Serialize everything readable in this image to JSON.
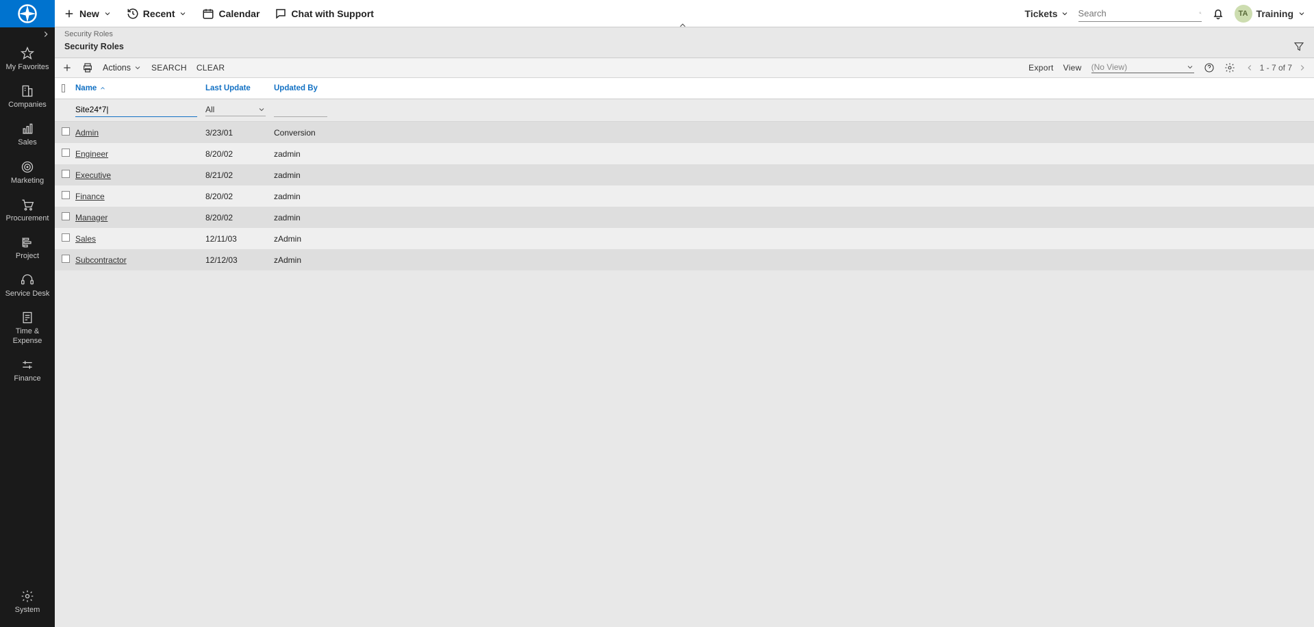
{
  "sidebar": {
    "items": [
      {
        "key": "favorites",
        "label": "My Favorites"
      },
      {
        "key": "companies",
        "label": "Companies"
      },
      {
        "key": "sales",
        "label": "Sales"
      },
      {
        "key": "marketing",
        "label": "Marketing"
      },
      {
        "key": "procurement",
        "label": "Procurement"
      },
      {
        "key": "project",
        "label": "Project"
      },
      {
        "key": "servicedesk",
        "label": "Service Desk"
      },
      {
        "key": "timeexpense",
        "label": "Time & Expense"
      },
      {
        "key": "finance",
        "label": "Finance"
      }
    ],
    "system_label": "System"
  },
  "topbar": {
    "new_label": "New",
    "recent_label": "Recent",
    "calendar_label": "Calendar",
    "chat_label": "Chat with Support",
    "tickets_label": "Tickets",
    "search_placeholder": "Search",
    "avatar_initials": "TA",
    "user_label": "Training"
  },
  "breadcrumb": "Security Roles",
  "page_title": "Security Roles",
  "toolbar": {
    "actions_label": "Actions",
    "search_label": "SEARCH",
    "clear_label": "CLEAR",
    "export_label": "Export",
    "view_label": "View",
    "view_value": "(No View)",
    "pager_text": "1 - 7 of 7"
  },
  "columns": {
    "name": "Name",
    "last_update": "Last Update",
    "updated_by": "Updated By"
  },
  "filters": {
    "name_value": "Site24*7|",
    "last_update_value": "All",
    "updated_by_value": ""
  },
  "rows": [
    {
      "name": "Admin",
      "last_update": "3/23/01",
      "updated_by": "Conversion"
    },
    {
      "name": "Engineer",
      "last_update": "8/20/02",
      "updated_by": "zadmin"
    },
    {
      "name": "Executive",
      "last_update": "8/21/02",
      "updated_by": "zadmin"
    },
    {
      "name": "Finance",
      "last_update": "8/20/02",
      "updated_by": "zadmin"
    },
    {
      "name": "Manager",
      "last_update": "8/20/02",
      "updated_by": "zadmin"
    },
    {
      "name": "Sales",
      "last_update": "12/11/03",
      "updated_by": "zAdmin"
    },
    {
      "name": "Subcontractor",
      "last_update": "12/12/03",
      "updated_by": "zAdmin"
    }
  ]
}
